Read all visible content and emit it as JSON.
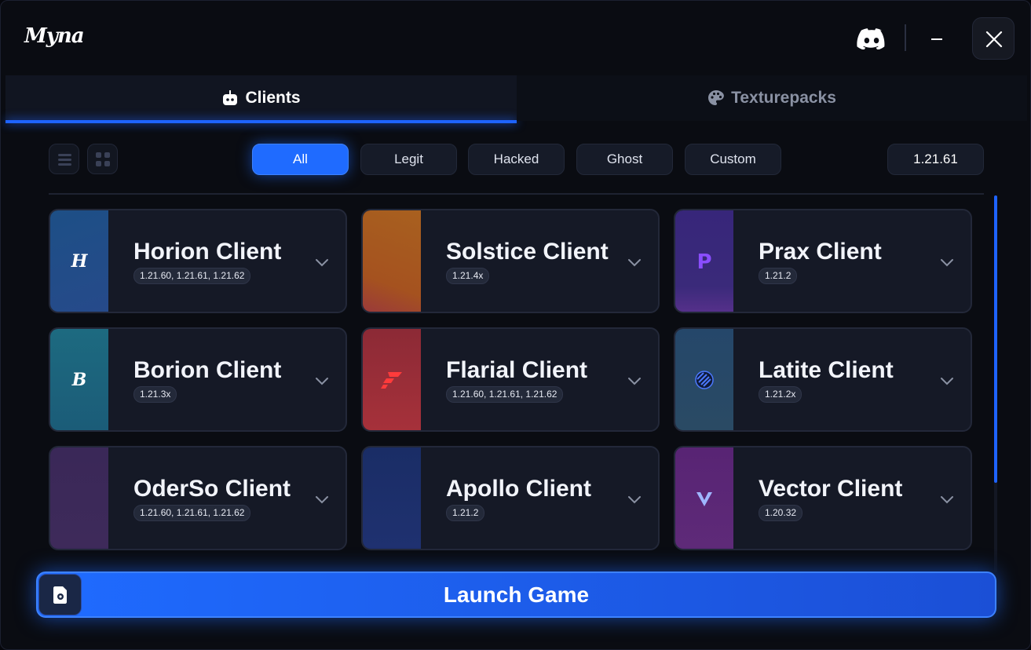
{
  "app": {
    "logo_text": "Myna"
  },
  "tabs": [
    {
      "label": "Clients",
      "icon": "robot-icon",
      "active": true
    },
    {
      "label": "Texturepacks",
      "icon": "palette-icon",
      "active": false
    }
  ],
  "filters": [
    {
      "label": "All",
      "active": true
    },
    {
      "label": "Legit",
      "active": false
    },
    {
      "label": "Hacked",
      "active": false
    },
    {
      "label": "Ghost",
      "active": false
    },
    {
      "label": "Custom",
      "active": false
    }
  ],
  "version_select": {
    "value": "1.21.61"
  },
  "clients": [
    {
      "name": "Horion Client",
      "versions": "1.21.60, 1.21.61, 1.21.62",
      "icon": "horion-logo",
      "color": "#1d4f86"
    },
    {
      "name": "Solstice Client",
      "versions": "1.21.4x",
      "icon": "solstice-logo",
      "color": "#b25a22"
    },
    {
      "name": "Prax Client",
      "versions": "1.21.2",
      "icon": "prax-logo",
      "color": "#3a2a7a"
    },
    {
      "name": "Borion Client",
      "versions": "1.21.3x",
      "icon": "borion-logo",
      "color": "#1b5f79"
    },
    {
      "name": "Flarial Client",
      "versions": "1.21.60, 1.21.61, 1.21.62",
      "icon": "flarial-logo",
      "color": "#a2313a"
    },
    {
      "name": "Latite Client",
      "versions": "1.21.2x",
      "icon": "latite-logo",
      "color": "#264a66"
    },
    {
      "name": "OderSo Client",
      "versions": "1.21.60, 1.21.61, 1.21.62",
      "icon": "oderso-logo",
      "color": "#3b2a5a"
    },
    {
      "name": "Apollo Client",
      "versions": "1.21.2",
      "icon": "apollo-logo",
      "color": "#1d2f66"
    },
    {
      "name": "Vector Client",
      "versions": "1.20.32",
      "icon": "vector-logo",
      "color": "#5a2673"
    }
  ],
  "launch": {
    "label": "Launch Game"
  },
  "colors": {
    "accent": "#1f6bff",
    "background": "#0a0c12",
    "card": "#151926"
  }
}
